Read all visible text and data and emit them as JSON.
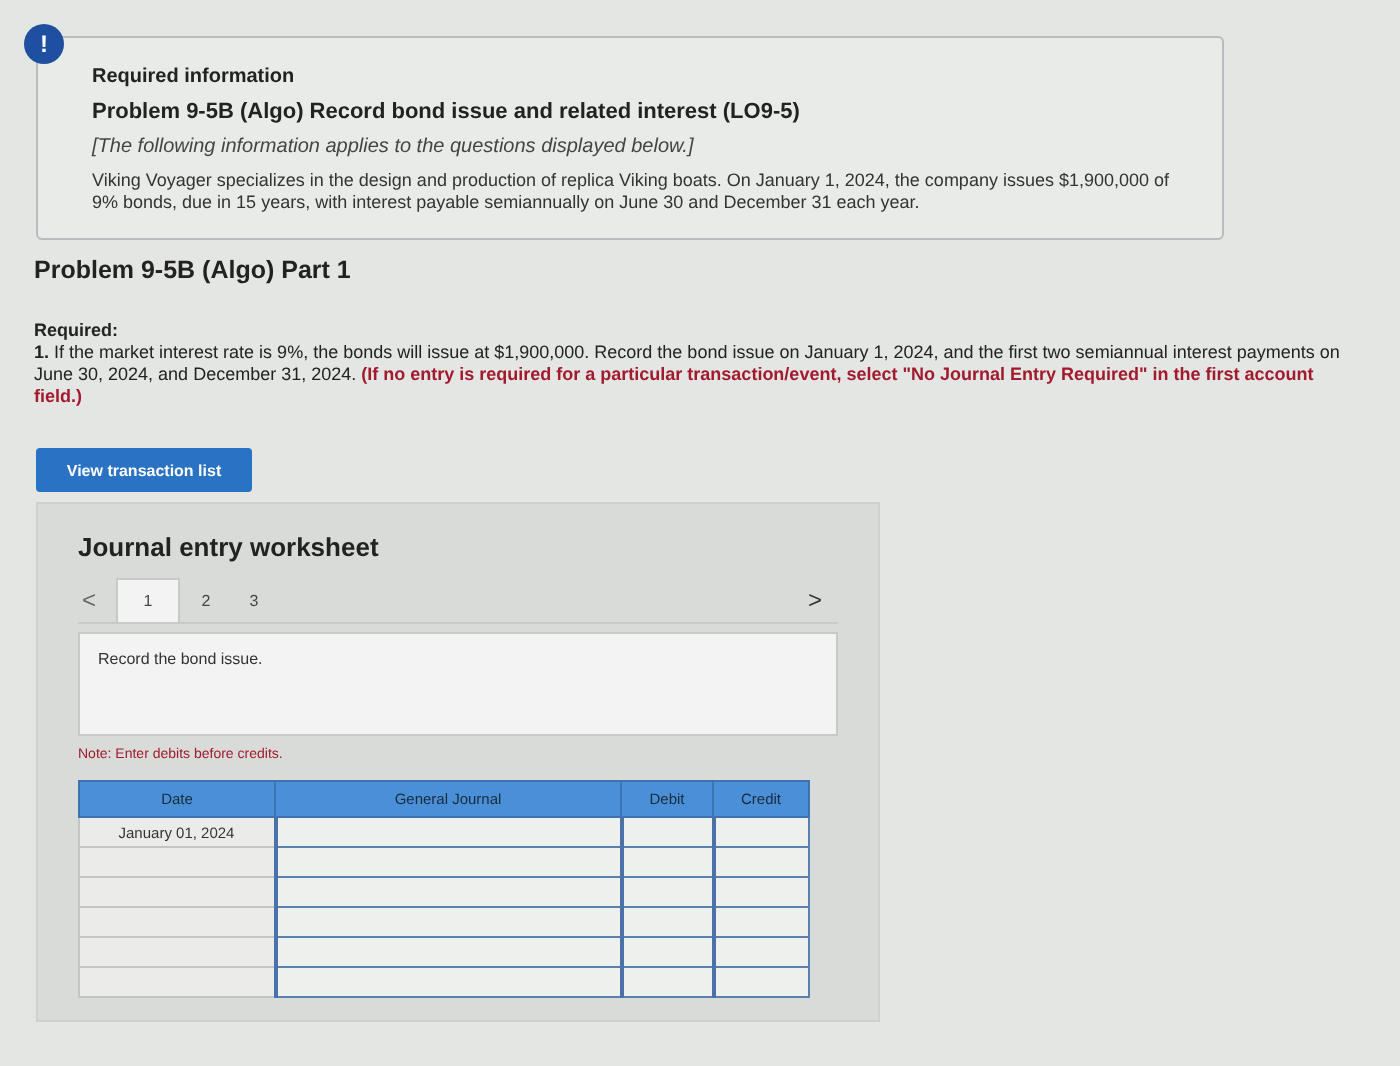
{
  "alert": {
    "icon": "!"
  },
  "info": {
    "heading": "Required information",
    "title": "Problem 9-5B (Algo) Record bond issue and related interest (LO9-5)",
    "note": "[The following information applies to the questions displayed below.]",
    "body": "Viking Voyager specializes in the design and production of replica Viking boats. On January 1, 2024, the company issues $1,900,000 of 9% bonds, due in 15 years, with interest payable semiannually on June 30 and December 31 each year."
  },
  "part_title": "Problem 9-5B (Algo) Part 1",
  "required": {
    "label": "Required:",
    "text": "**1.** If the market interest rate is 9%, the bonds will issue at $1,900,000. Record the bond issue on January 1, 2024, and the first two semiannual interest payments on June 30, 2024, and December 31, 2024.",
    "instruction": "(If no entry is required for a particular transaction/event, select \"No Journal Entry Required\" in the first account field.)"
  },
  "view_button": "View transaction list",
  "worksheet": {
    "title": "Journal entry worksheet",
    "prev": "<",
    "next": ">",
    "steps": [
      {
        "label": "1",
        "selected": true
      },
      {
        "label": "2",
        "selected": false
      },
      {
        "label": "3",
        "selected": false
      }
    ],
    "prompt": "Record the bond issue.",
    "note": "Note: Enter debits before credits.",
    "table": {
      "columns": [
        "Date",
        "General Journal",
        "Debit",
        "Credit"
      ],
      "rows": [
        {
          "kind": "dated",
          "date": "January 01, 2024"
        },
        {
          "kind": "blank"
        },
        {
          "kind": "blank"
        },
        {
          "kind": "blank"
        },
        {
          "kind": "blank"
        },
        {
          "kind": "blank"
        }
      ]
    }
  }
}
